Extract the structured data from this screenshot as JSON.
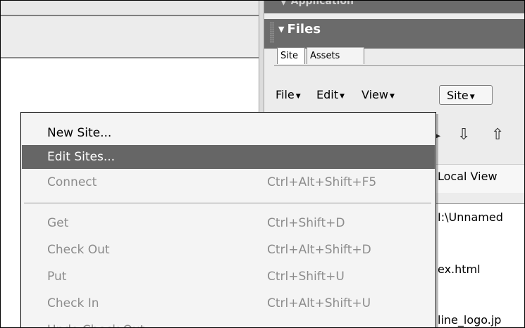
{
  "app_panel": {
    "title": "▼ Application"
  },
  "files_panel": {
    "title": "Files",
    "tabs": [
      "Site",
      "Assets"
    ],
    "menubar": {
      "file": "File",
      "edit": "Edit",
      "view": "View",
      "site": "Site"
    },
    "view_select": "Local View",
    "path": "I:\\Unnamed",
    "files": [
      "ex.html",
      "line_logo.jp"
    ]
  },
  "site_menu": {
    "items": [
      {
        "label": "New Site...",
        "shortcut": "",
        "state": "enabled"
      },
      {
        "label": "Edit Sites...",
        "shortcut": "",
        "state": "highlighted"
      },
      {
        "label": "Connect",
        "shortcut": "Ctrl+Alt+Shift+F5",
        "state": "disabled"
      },
      {
        "label": "Get",
        "shortcut": "Ctrl+Shift+D",
        "state": "disabled"
      },
      {
        "label": "Check Out",
        "shortcut": "Ctrl+Alt+Shift+D",
        "state": "disabled"
      },
      {
        "label": "Put",
        "shortcut": "Ctrl+Shift+U",
        "state": "disabled"
      },
      {
        "label": "Check In",
        "shortcut": "Ctrl+Alt+Shift+U",
        "state": "disabled"
      },
      {
        "label": "Undo Check Out",
        "shortcut": "",
        "state": "disabled"
      }
    ]
  },
  "icons": {
    "get": "get-arrow-icon",
    "put": "put-arrow-icon",
    "menu_caret": "chevron-down-icon"
  },
  "colors": {
    "panel_header": "#6b6b6b",
    "highlight": "#666666",
    "disabled_text": "#8c8c8c"
  }
}
